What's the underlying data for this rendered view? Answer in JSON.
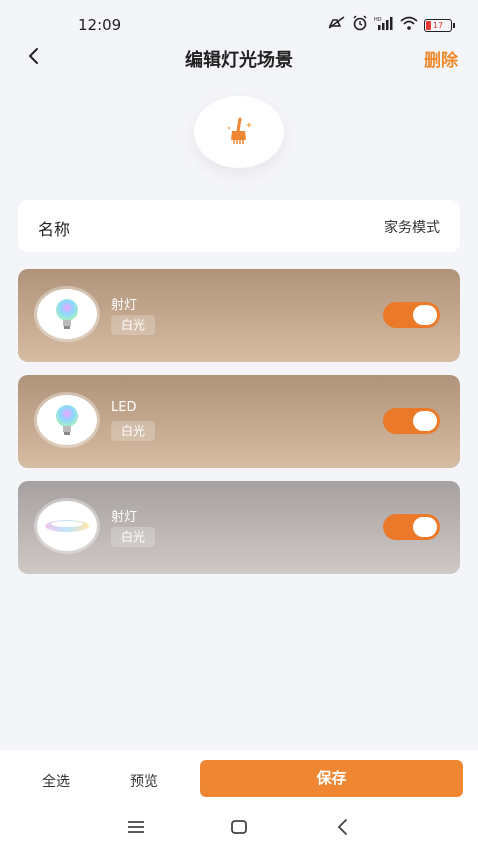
{
  "status_bar": {
    "time": "12:09",
    "battery": "17"
  },
  "header": {
    "title": "编辑灯光场景",
    "delete_label": "删除"
  },
  "scene": {
    "icon": "broom-icon",
    "name_label": "名称",
    "name_value": "家务模式"
  },
  "devices": [
    {
      "name": "射灯",
      "mode": "白光",
      "on": true,
      "icon": "bulb-icon"
    },
    {
      "name": "LED",
      "mode": "白光",
      "on": true,
      "icon": "bulb-icon"
    },
    {
      "name": "射灯",
      "mode": "白光",
      "on": true,
      "icon": "ceiling-light-icon"
    }
  ],
  "bottom": {
    "select_all": "全选",
    "preview": "预览",
    "save": "保存"
  },
  "colors": {
    "accent": "#ef8631",
    "background": "#f4f5f9"
  }
}
